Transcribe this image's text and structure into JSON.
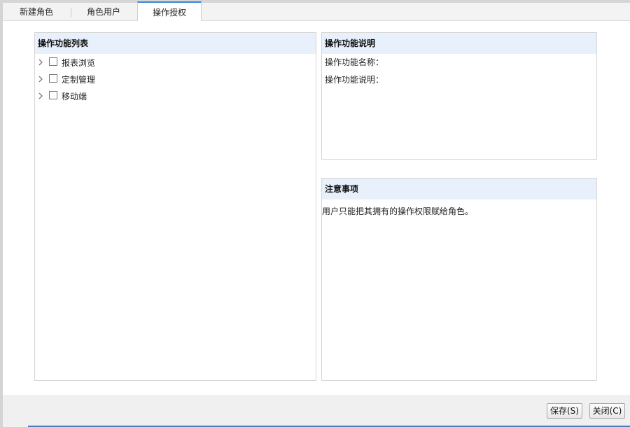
{
  "tabs": [
    {
      "label": "新建角色"
    },
    {
      "label": "角色用户"
    },
    {
      "label": "操作授权"
    }
  ],
  "function_list": {
    "title": "操作功能列表",
    "items": [
      {
        "label": "报表浏览"
      },
      {
        "label": "定制管理"
      },
      {
        "label": "移动端"
      }
    ]
  },
  "function_desc": {
    "title": "操作功能说明",
    "name_label": "操作功能名称：",
    "desc_label": "操作功能说明："
  },
  "notes": {
    "title": "注意事项",
    "text": "用户只能把其拥有的操作权限赋给角色。"
  },
  "footer": {
    "save_label": "保存(S)",
    "close_label": "关闭(C)"
  },
  "colors": {
    "active_tab_accent": "#3c86d6",
    "panel_header_bg": "#e8f0fc"
  }
}
